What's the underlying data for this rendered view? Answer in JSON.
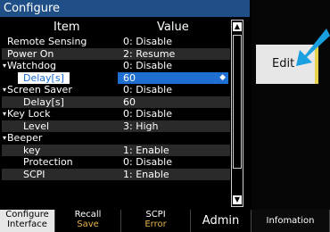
{
  "window": {
    "title": "Configure"
  },
  "columns": {
    "item": "Item",
    "value": "Value"
  },
  "rows": [
    {
      "name": "Remote Sensing",
      "value": "0: Disable",
      "indent": false,
      "expander": false,
      "alt": false
    },
    {
      "name": "Power On",
      "value": "2: Resume",
      "indent": false,
      "expander": false,
      "alt": true
    },
    {
      "name": "Watchdog",
      "value": "0: Disable",
      "indent": false,
      "expander": true,
      "alt": false
    },
    {
      "name": "Delay[s]",
      "value": "60",
      "indent": true,
      "expander": false,
      "selected": true
    },
    {
      "name": "Screen Saver",
      "value": "0: Disable",
      "indent": false,
      "expander": true,
      "alt": false
    },
    {
      "name": "Delay[s]",
      "value": "60",
      "indent": true,
      "expander": false,
      "alt": true
    },
    {
      "name": "Key Lock",
      "value": "0: Disable",
      "indent": false,
      "expander": true,
      "alt": false
    },
    {
      "name": "Level",
      "value": "3: High",
      "indent": true,
      "expander": false,
      "alt": true
    },
    {
      "name": "Beeper",
      "value": "",
      "indent": false,
      "expander": true,
      "alt": false
    },
    {
      "name": "key",
      "value": "1: Enable",
      "indent": true,
      "expander": false,
      "alt": true
    },
    {
      "name": "Protection",
      "value": "0: Disable",
      "indent": true,
      "expander": false,
      "alt": false
    },
    {
      "name": "SCPI",
      "value": "1: Enable",
      "indent": true,
      "expander": false,
      "alt": true
    }
  ],
  "expander_glyph": "▾",
  "spin_glyph": "◆",
  "scroll_up_glyph": "▲",
  "scroll_down_glyph": "▼",
  "edit_button": {
    "label": "Edit"
  },
  "softkeys": [
    {
      "line1": "Configure",
      "line2": "Interface",
      "active": true
    },
    {
      "line1": "Recall",
      "line2": "Save",
      "active": false
    },
    {
      "line1": "SCPI",
      "line2": "Error",
      "active": false
    },
    {
      "line1": "Admin",
      "line2": "",
      "active": false
    },
    {
      "line1": "Infomation",
      "line2": "",
      "active": false
    }
  ],
  "colors": {
    "title_bar": "#1f4f86",
    "selection": "#1f6ed1",
    "arrow": "#1aa0e0",
    "softkey_accent": "#e7b04a"
  }
}
